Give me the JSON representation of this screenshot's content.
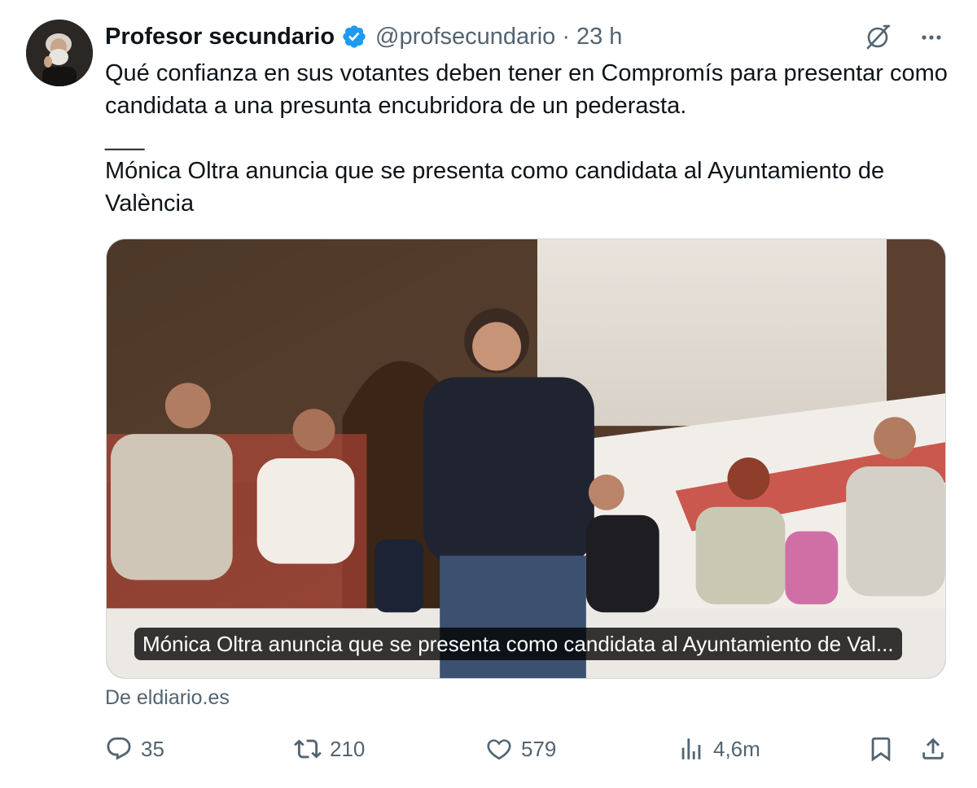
{
  "tweet": {
    "author_name": "Profesor secundario",
    "handle": "@profsecundario",
    "separator": "·",
    "time": "23 h",
    "text_line_1": "Qué confianza en sus votantes deben tener en Compromís para presentar como candidata a una presunta encubridora de un pederasta.",
    "separator_line": "___",
    "text_line_2": "Mónica Oltra anuncia que se presenta como candidata al Ayuntamiento de València"
  },
  "card": {
    "caption": "Mónica Oltra anuncia que se presenta como candidata al Ayuntamiento de Val...",
    "source": "De eldiario.es"
  },
  "actions": {
    "replies": "35",
    "reposts": "210",
    "likes": "579",
    "views": "4,6m"
  },
  "icons": [
    "verified-badge-icon",
    "grok-icon",
    "more-icon",
    "reply-icon",
    "repost-icon",
    "like-icon",
    "views-icon",
    "bookmark-icon",
    "share-icon"
  ],
  "colors": {
    "verified": "#1d9bf0",
    "secondary_text": "#536471",
    "primary_text": "#0f1419"
  }
}
